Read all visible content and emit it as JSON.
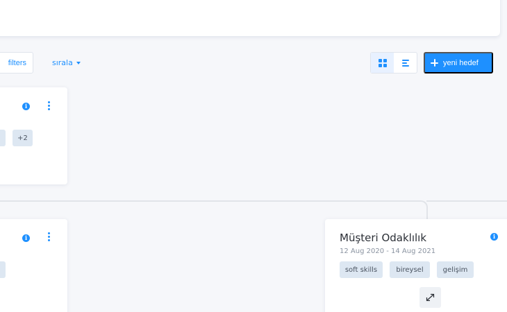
{
  "toolbar": {
    "filters_label": "filters",
    "sort_label": "sırala",
    "new_goal_label": "yeni hedef"
  },
  "view_toggle": {
    "active": "grid"
  },
  "cards": [
    {
      "tags": [
        "+2"
      ]
    },
    {
      "tags": []
    },
    {
      "title": "Müşteri Odaklılık",
      "dates": "12 Aug 2020 - 14 Aug 2021",
      "tags": [
        "soft skills",
        "bireysel",
        "gelişim"
      ]
    }
  ],
  "icons": [
    "info-icon",
    "kebab-menu-icon",
    "grid-view-icon",
    "list-view-icon",
    "plus-icon",
    "expand-icon",
    "caret-down-icon"
  ],
  "colors": {
    "accent": "#1e90ff",
    "tag_bg": "#dde7f2",
    "background": "#f6f7fa"
  }
}
